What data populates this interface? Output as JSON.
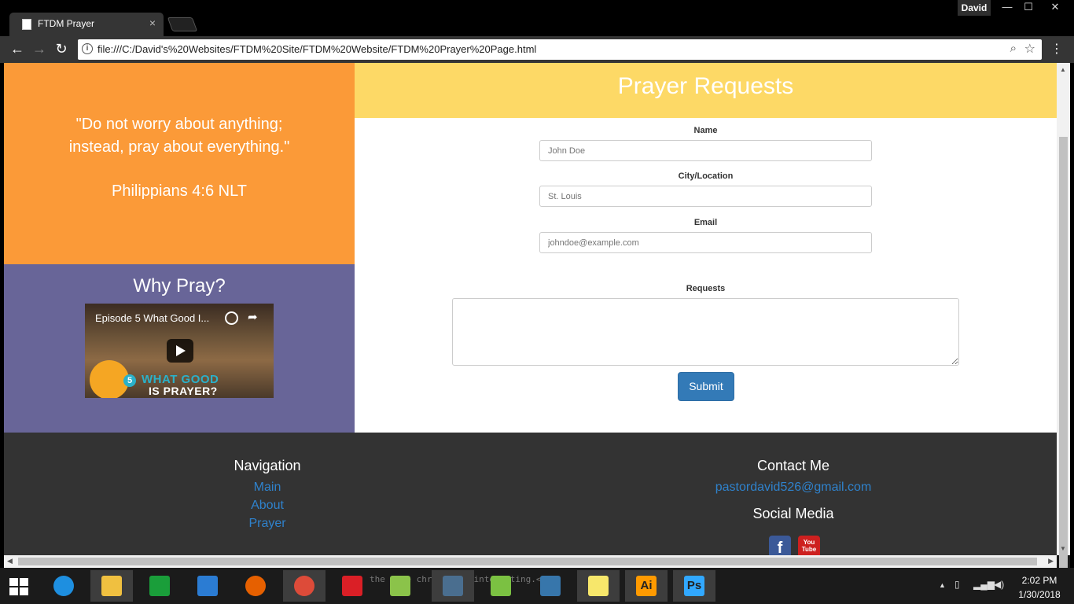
{
  "browser": {
    "tab_title": "FTDM Prayer",
    "tab_close": "×",
    "profile": "David",
    "url": "file:///C:/David's%20Websites/FTDM%20Site/FTDM%20Website/FTDM%20Prayer%20Page.html",
    "nav": {
      "back": "←",
      "forward": "→",
      "reload": "↻",
      "menu": "⋮",
      "zoom": "⌕",
      "bookmark": "☆"
    },
    "window": {
      "minimize": "—",
      "maximize": "☐",
      "close": "✕"
    }
  },
  "page": {
    "quote": {
      "line1": "\"Do not worry about anything;",
      "line2": "instead, pray about everything.\"",
      "reference": "Philippians 4:6 NLT"
    },
    "why_pray": {
      "title": "Why Pray?",
      "video": {
        "title": "Episode 5 What Good I...",
        "episode": "5",
        "banner_line1": "WHAT GOOD",
        "banner_line2": "IS PRAYER?"
      }
    },
    "form": {
      "heading": "Prayer Requests",
      "name_label": "Name",
      "name_placeholder": "John Doe",
      "city_label": "City/Location",
      "city_placeholder": "St. Louis",
      "email_label": "Email",
      "email_placeholder": "johndoe@example.com",
      "requests_label": "Requests",
      "submit_label": "Submit"
    },
    "footer": {
      "nav_title": "Navigation",
      "nav_links": [
        "Main",
        "About",
        "Prayer"
      ],
      "contact_title": "Contact Me",
      "email": "pastordavid526@gmail.com",
      "social_title": "Social Media",
      "social": [
        {
          "name": "facebook-icon",
          "glyph": "f",
          "color": "#3b5998"
        },
        {
          "name": "youtube-icon",
          "glyph": "You Tube",
          "color": "#cd201f"
        }
      ]
    }
  },
  "taskbar": {
    "background_code": "the      r se       chri   an ke    interesting.<",
    "apps": [
      {
        "name": "internet-explorer-icon",
        "color": "#1e8fe0"
      },
      {
        "name": "file-explorer-icon",
        "color": "#f0c040"
      },
      {
        "name": "store-icon",
        "color": "#1a9e3a"
      },
      {
        "name": "onedrive-icon",
        "color": "#2b7cd3"
      },
      {
        "name": "firefox-icon",
        "color": "#e66000"
      },
      {
        "name": "chrome-icon",
        "color": "#dd4b39"
      },
      {
        "name": "creative-cloud-icon",
        "color": "#da1f26"
      },
      {
        "name": "notepad-plus-icon",
        "color": "#8bc34a"
      },
      {
        "name": "brackets-icon",
        "color": "#4a6e8f"
      },
      {
        "name": "android-studio-icon",
        "color": "#7bc142"
      },
      {
        "name": "python-icon",
        "color": "#3776ab"
      },
      {
        "name": "sticky-notes-icon",
        "color": "#f7e76b"
      },
      {
        "name": "illustrator-icon",
        "color": "#ff9a00",
        "label": "Ai"
      },
      {
        "name": "photoshop-icon",
        "color": "#31a8ff",
        "label": "Ps"
      }
    ],
    "time": "2:02 PM",
    "date": "1/30/2018"
  }
}
